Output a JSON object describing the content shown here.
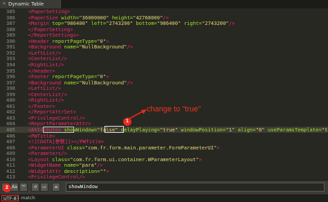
{
  "tab": {
    "title": "Dynamic Table",
    "close": "×"
  },
  "lines": [
    {
      "n": "385",
      "t": "  <PaperSetting>"
    },
    {
      "n": "386",
      "t": "  <PaperSize width=\"36000000\" height=\"42768000\"/>"
    },
    {
      "n": "387",
      "t": "  <Margin top=\"986400\" left=\"2743200\" bottom=\"986400\" right=\"2743200\"/>"
    },
    {
      "n": "388",
      "t": "  </PaperSetting>"
    },
    {
      "n": "389",
      "t": "  </ReportSettings>"
    },
    {
      "n": "390",
      "t": "  <Header reportPageType=\"0\">"
    },
    {
      "n": "391",
      "t": "  <Background name=\"NullBackground\"/>"
    },
    {
      "n": "392",
      "t": "  <LeftList/>"
    },
    {
      "n": "393",
      "t": "  <CenterList/>"
    },
    {
      "n": "394",
      "t": "  <RightList/>"
    },
    {
      "n": "395",
      "t": "  </Header>"
    },
    {
      "n": "396",
      "t": "  <Footer reportPageType=\"0\">"
    },
    {
      "n": "397",
      "t": "  <Background name=\"NullBackground\"/>"
    },
    {
      "n": "398",
      "t": "  <LeftList/>"
    },
    {
      "n": "399",
      "t": "  <CenterList/>"
    },
    {
      "n": "400",
      "t": "  <RightList/>"
    },
    {
      "n": "401",
      "t": "  </Footer>"
    },
    {
      "n": "402",
      "t": "  </ReportAttrSet>"
    },
    {
      "n": "403",
      "t": "  <PrivilegeControl/>"
    },
    {
      "n": "404",
      "t": "  <ReportParameterAttr>"
    },
    {
      "n": "405",
      "t": "  <Attributes showWindow=\"false\" delayPlaying=\"true\" windowPosition=\"1\" align=\"0\" useParamsTemplate=\"true\"/>"
    },
    {
      "n": "406",
      "t": "  <PWTitle>"
    },
    {
      "n": "407",
      "t": "  <![CDATA[参数]]></PWTitle>"
    },
    {
      "n": "408",
      "t": "  <ParameterUI class=\"com.fr.form.main.parameter.FormParameterUI\">"
    },
    {
      "n": "409",
      "t": "  <Parameters/>"
    },
    {
      "n": "410",
      "t": "  <Layout class=\"com.fr.form.ui.container.WParameterLayout\">"
    },
    {
      "n": "411",
      "t": "  <WidgetName name=\"para\"/>"
    },
    {
      "n": "412",
      "t": "  <WidgetAttr description=\"\">"
    },
    {
      "n": "413",
      "t": "  <PrivilegeControl/>"
    }
  ],
  "annotation": {
    "text": "change to \"true\"",
    "badge1": "1",
    "badge2": "2"
  },
  "findbar": {
    "btn_regex": ".*",
    "btn_case": "Aa",
    "btn_word": "\"\"",
    "btn_wrap": "↺",
    "btn_insel": "▭",
    "btn_highlight": "≡",
    "query": "showWindow"
  },
  "status": {
    "encoding": "UTF-8",
    "matches": "1 match"
  },
  "colors": {
    "accent": "#e62a1f",
    "background": "#272822",
    "tag": "#f92672",
    "attr": "#a6e22e",
    "string": "#e6db74"
  }
}
